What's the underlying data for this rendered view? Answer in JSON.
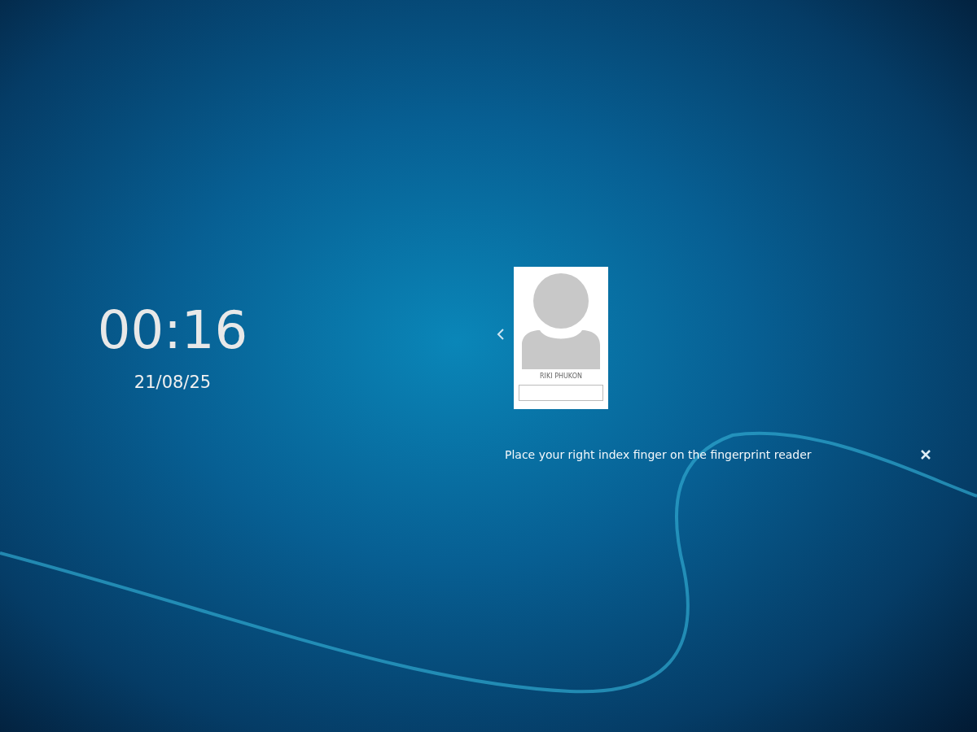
{
  "clock": {
    "time": "00:16",
    "date": "21/08/25"
  },
  "user_card": {
    "name": "RIKI PHUKON"
  },
  "message": {
    "text": "Place your right index finger on the fingerprint reader"
  }
}
